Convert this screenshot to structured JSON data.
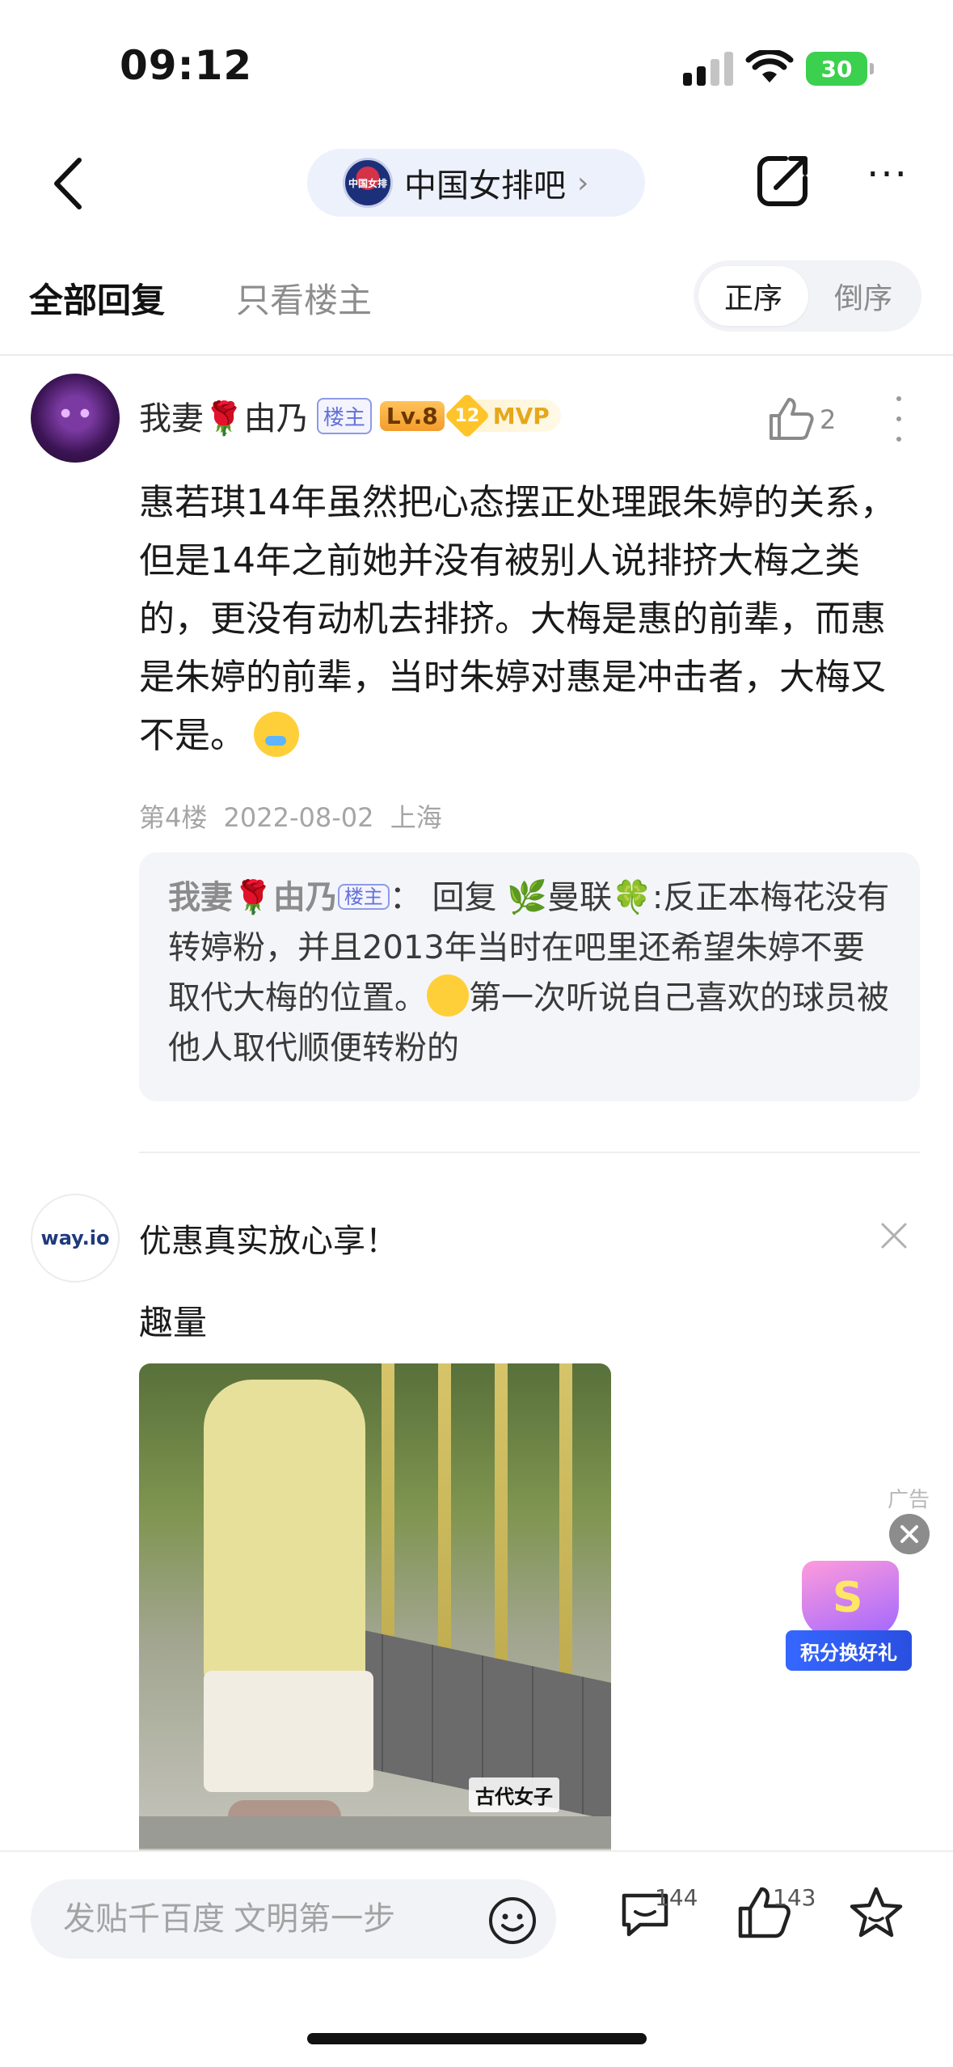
{
  "status_bar": {
    "time": "09:12",
    "battery": "30"
  },
  "nav": {
    "forum_name": "中国女排吧",
    "forum_logo_text": "中国女排",
    "chevron": "›",
    "more": "···"
  },
  "tabs": {
    "all_replies": "全部回复",
    "op_only": "只看楼主",
    "sort_asc": "正序",
    "sort_desc": "倒序"
  },
  "post": {
    "author": "我妻🌹由乃",
    "badge_op": "楼主",
    "badge_level": "Lv.8",
    "mvp_level": "12",
    "mvp_label": "MVP",
    "like_count": "2",
    "body": "惠若琪14年虽然把心态摆正处理跟朱婷的关系，但是14年之前她并没有被别人说排挤大梅之类的，更没有动机去排挤。大梅是惠的前辈，而惠是朱婷的前辈，当时朱婷对惠是冲击者，大梅又不是。",
    "floor": "第4楼",
    "date": "2022-08-02",
    "location": "上海"
  },
  "reply": {
    "author_prefix": "我妻",
    "author_rose": "🌹",
    "author_suffix": "由乃",
    "badge_op": "楼主",
    "colon": "：",
    "reply_word": "回复",
    "target_leaf": "🌿",
    "target_name": "曼联",
    "target_clover": "🍀",
    "text_a": ":反正本梅花没有转婷粉，并且2013年当时在吧里还希望朱婷不要取代大梅的位置。",
    "text_b": "第一次听说自己喜欢的球员被他人取代顺便转粉的"
  },
  "ad": {
    "logo_text": "way.io",
    "title": "优惠真实放心享！",
    "brand": "趣量",
    "image_caption": "古代女子",
    "ad_label": "广告",
    "promo_label": "积分换好礼"
  },
  "bottom_bar": {
    "compose_placeholder": "发贴千百度 文明第一步",
    "comment_count": "144",
    "like_count": "143"
  },
  "colors": {
    "accent_blue": "#6471d8",
    "level_orange": "#f39c2c",
    "mvp_gold": "#ffc42a",
    "battery_green": "#3bd04e"
  }
}
